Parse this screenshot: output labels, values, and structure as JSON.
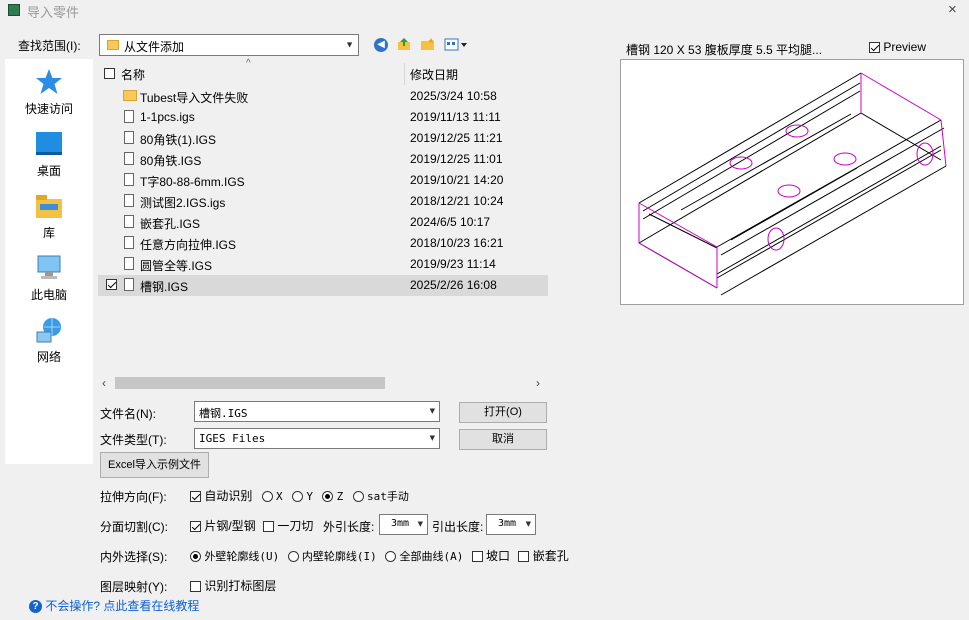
{
  "window": {
    "title": "导入零件",
    "close_icon": "×"
  },
  "lookin": {
    "label": "查找范围(I):",
    "value": "从文件添加"
  },
  "places": [
    {
      "label": "快速访问",
      "icon": "star-icon"
    },
    {
      "label": "桌面",
      "icon": "desktop-icon"
    },
    {
      "label": "库",
      "icon": "library-icon"
    },
    {
      "label": "此电脑",
      "icon": "computer-icon"
    },
    {
      "label": "网络",
      "icon": "network-icon"
    }
  ],
  "columns": {
    "name": "名称",
    "modified": "修改日期"
  },
  "files": [
    {
      "name": "Tubest导入文件失败",
      "date": "2025/3/24 10:58",
      "type": "folder"
    },
    {
      "name": "1-1pcs.igs",
      "date": "2019/11/13 11:11",
      "type": "file"
    },
    {
      "name": "80角铁(1).IGS",
      "date": "2019/12/25 11:21",
      "type": "file"
    },
    {
      "name": "80角铁.IGS",
      "date": "2019/12/25 11:01",
      "type": "file"
    },
    {
      "name": "T字80-88-6mm.IGS",
      "date": "2019/10/21 14:20",
      "type": "file"
    },
    {
      "name": "测试图2.IGS.igs",
      "date": "2018/12/21 10:24",
      "type": "file"
    },
    {
      "name": "嵌套孔.IGS",
      "date": "2024/6/5 10:17",
      "type": "file"
    },
    {
      "name": "任意方向拉伸.IGS",
      "date": "2018/10/23 16:21",
      "type": "file"
    },
    {
      "name": "圆管全等.IGS",
      "date": "2019/9/23 11:14",
      "type": "file"
    },
    {
      "name": "槽钢.IGS",
      "date": "2025/2/26 16:08",
      "type": "file",
      "selected": true
    }
  ],
  "filename": {
    "label": "文件名(N):",
    "value": "槽钢.IGS"
  },
  "filetype": {
    "label": "文件类型(T):",
    "value": "IGES Files"
  },
  "buttons": {
    "open": "打开(O)",
    "cancel": "取消",
    "excel": "Excel导入示例文件"
  },
  "preview": {
    "title": "槽钢 120 X 53 腹板厚度 5.5 平均腿...",
    "toggle_label": "Preview",
    "checked": true
  },
  "extrude": {
    "label": "拉伸方向(F):",
    "auto_label": "自动识别",
    "auto_checked": true,
    "options": [
      "X",
      "Y",
      "Z",
      "sat手动"
    ],
    "selected": "Z"
  },
  "split": {
    "label": "分面切割(C):",
    "plate_label": "片钢/型钢",
    "plate_checked": true,
    "onecut_label": "一刀切",
    "onecut_checked": false,
    "lead_in_label": "外引长度:",
    "lead_in_value": "3mm",
    "lead_out_label": "引出长度:",
    "lead_out_value": "3mm"
  },
  "select": {
    "label": "内外选择(S):",
    "options": [
      "外壁轮廓线(U)",
      "内壁轮廓线(I)",
      "全部曲线(A)"
    ],
    "selected": "外壁轮廓线(U)",
    "bevel_label": "坡口",
    "nest_label": "嵌套孔"
  },
  "layer": {
    "label": "图层映射(Y):",
    "checkbox_label": "识别打标图层"
  },
  "help": {
    "text": "不会操作? 点此查看在线教程"
  },
  "colors": {
    "accent": "#0b5fd6",
    "selection": "#d9d9d9",
    "preview_hole": "#cc00cc"
  }
}
